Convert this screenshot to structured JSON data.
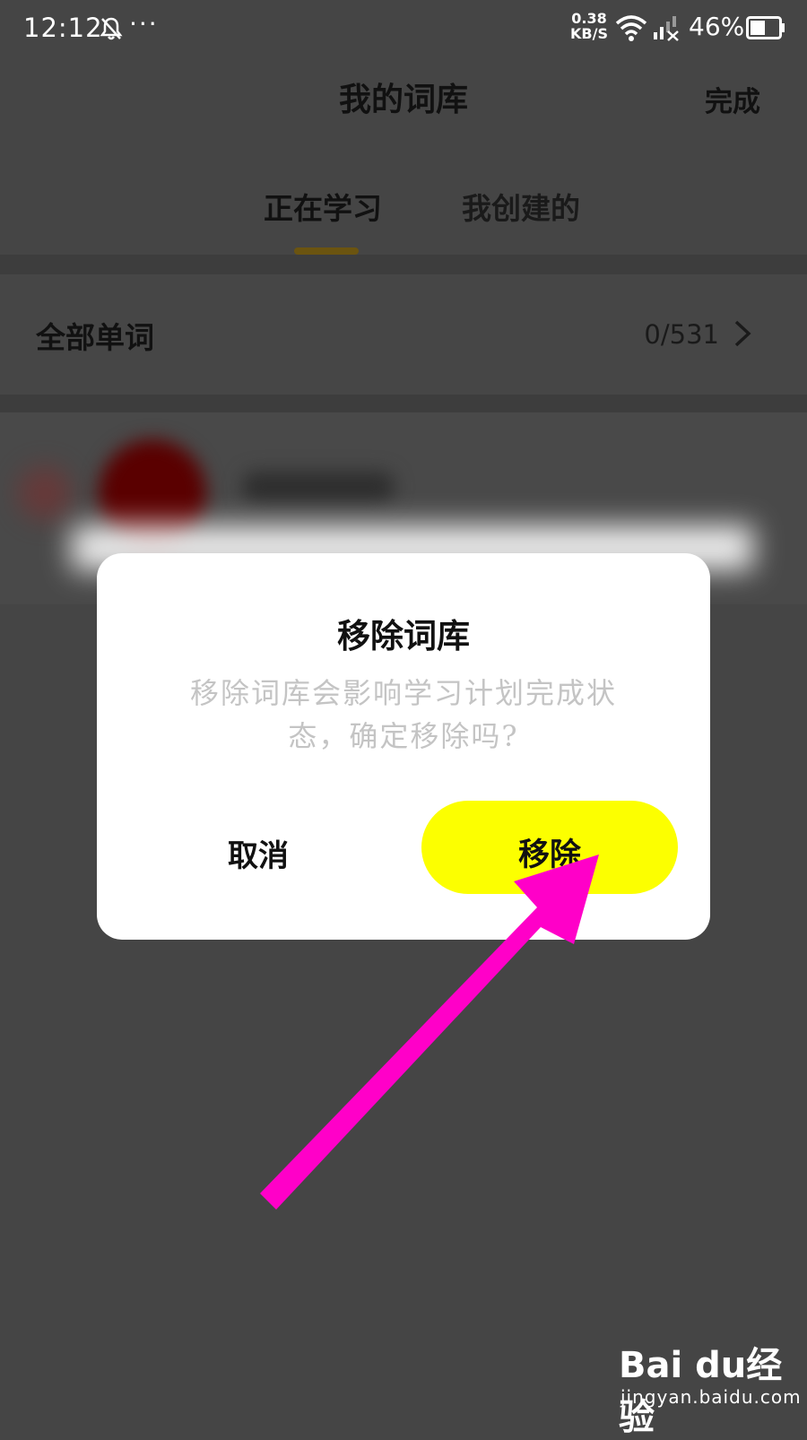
{
  "status_bar": {
    "time": "12:12",
    "dots": "···",
    "net_speed_value": "0.38",
    "net_speed_unit": "KB/S",
    "battery": "46%"
  },
  "header": {
    "title": "我的词库",
    "done_label": "完成"
  },
  "tabs": [
    {
      "label": "正在学习",
      "active": true
    },
    {
      "label": "我创建的",
      "active": false
    }
  ],
  "all_words": {
    "label": "全部单词",
    "count": "0/531"
  },
  "dialog": {
    "title": "移除词库",
    "message": "移除词库会影响学习计划完成状态，确定移除吗?",
    "cancel_label": "取消",
    "confirm_label": "移除"
  },
  "watermark": {
    "brand": "Bai du经验",
    "url": "jingyan.baidu.com"
  },
  "colors": {
    "background": "#454545",
    "accent_yellow": "#fcff00",
    "tab_indicator": "#6b5410",
    "annotation_arrow": "#ff00c8"
  }
}
